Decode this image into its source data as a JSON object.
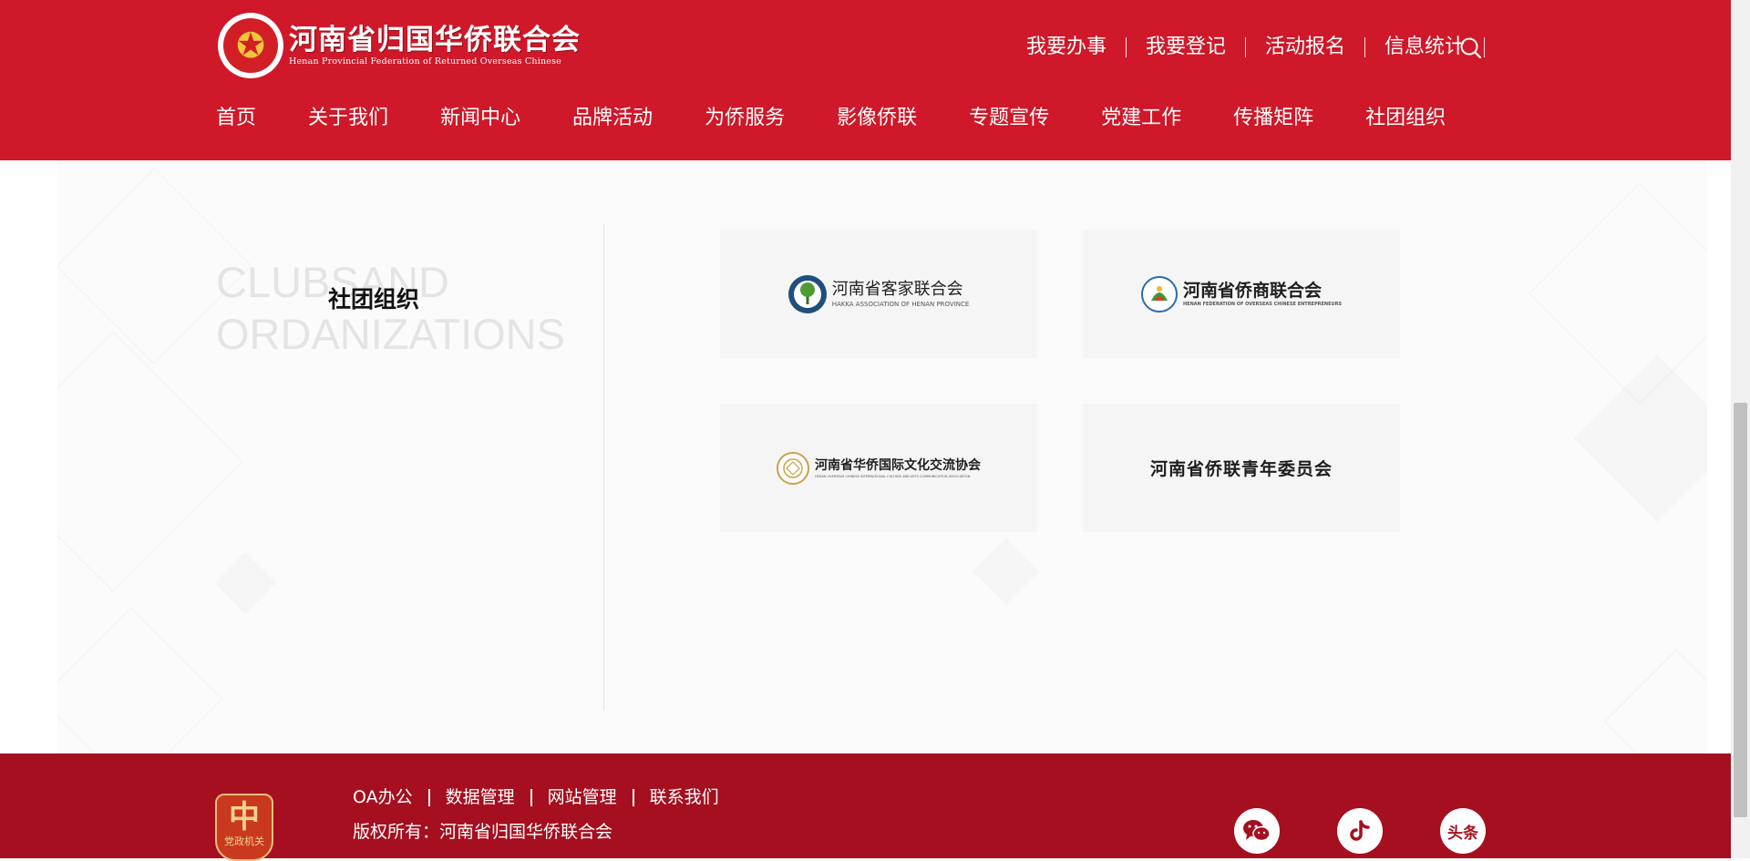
{
  "header": {
    "logo_cn": "河南省归国华侨联合会",
    "logo_en": "Henan Provincial Federation of Returned Overseas Chinese",
    "quick_links": [
      "我要办事",
      "我要登记",
      "活动报名",
      "信息统计"
    ],
    "nav": [
      "首页",
      "关于我们",
      "新闻中心",
      "品牌活动",
      "为侨服务",
      "影像侨联",
      "专题宣传",
      "党建工作",
      "传播矩阵",
      "社团组织"
    ],
    "search_icon": "search-icon"
  },
  "section": {
    "title_en": "CLUBSAND ORDANIZATIONS",
    "title_cn": "社团组织"
  },
  "orgs": [
    {
      "name": "河南省客家联合会",
      "name_en": "HAKKA ASSOCIATION OF HENAN PROVINCE"
    },
    {
      "name": "河南省侨商联合会",
      "name_en": "HENAN FEDERATION OF OVERSEAS CHINESE ENTREPRENEURS"
    },
    {
      "name": "河南省华侨国际文化交流协会",
      "name_en": "HENAN OVERSEAS CHINESE INTERNATIONAL CULTURE AND ARTS COMMUNICATION ASSOCIATION"
    },
    {
      "name": "河南省侨联青年委员会"
    }
  ],
  "footer": {
    "links": [
      "OA办公",
      "数据管理",
      "网站管理",
      "联系我们"
    ],
    "copyright": "版权所有：河南省归国华侨联合会",
    "badge_label": "党政机关",
    "social": [
      {
        "icon": "wechat-icon"
      },
      {
        "icon": "douyin-icon"
      },
      {
        "icon": "toutiao-icon",
        "label": "头条"
      }
    ]
  },
  "colors": {
    "header_bg": "#cf1829",
    "footer_bg": "#a50f1f",
    "card_bg": "#f5f5f5"
  }
}
